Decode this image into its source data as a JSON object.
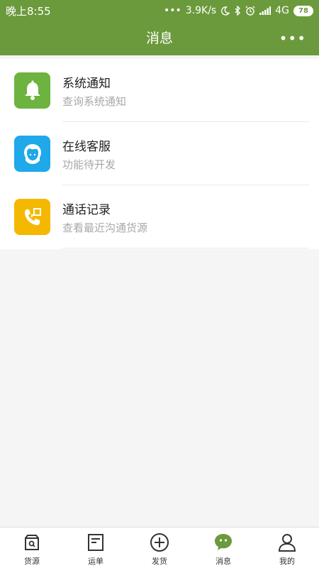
{
  "status_bar": {
    "time": "晚上8:55",
    "network_speed": "3.9K/s",
    "network_type": "4G",
    "battery": "78"
  },
  "header": {
    "title": "消息",
    "more_label": "•••"
  },
  "messages": [
    {
      "title": "系统通知",
      "subtitle": "查询系统通知",
      "icon": "bell-icon",
      "color": "#6cb33f"
    },
    {
      "title": "在线客服",
      "subtitle": "功能待开发",
      "icon": "customer-service-icon",
      "color": "#1fa8ea"
    },
    {
      "title": "通话记录",
      "subtitle": "查看最近沟通货源",
      "icon": "phone-record-icon",
      "color": "#f5b800"
    }
  ],
  "tabbar": {
    "items": [
      {
        "label": "货源",
        "icon": "cargo-source-icon",
        "active": false
      },
      {
        "label": "运单",
        "icon": "waybill-icon",
        "active": false
      },
      {
        "label": "发货",
        "icon": "add-circle-icon",
        "active": false
      },
      {
        "label": "消息",
        "icon": "message-bubble-icon",
        "active": true
      },
      {
        "label": "我的",
        "icon": "user-icon",
        "active": false
      }
    ]
  },
  "colors": {
    "primary": "#6b9a3c",
    "active_tab": "#6b9a3c"
  }
}
